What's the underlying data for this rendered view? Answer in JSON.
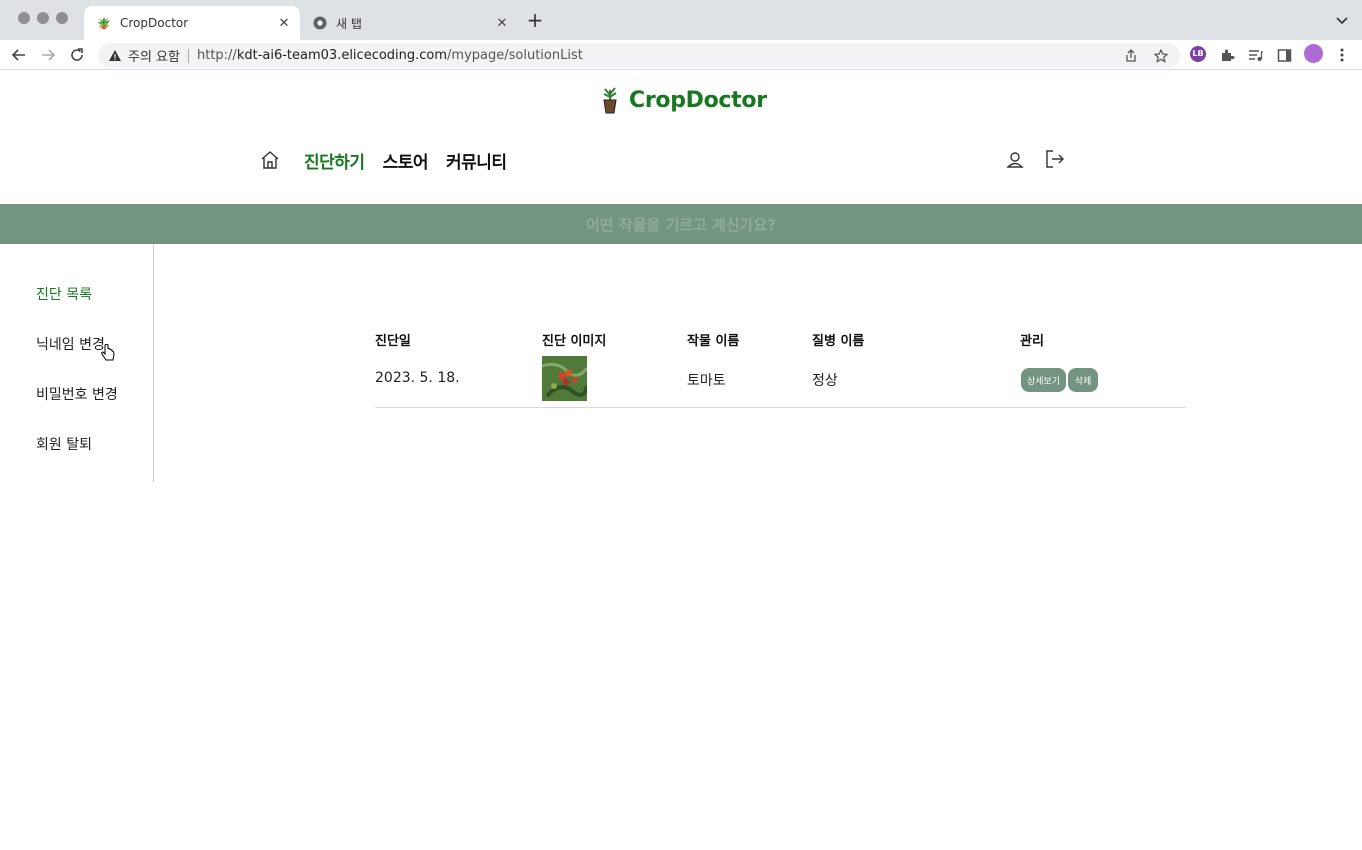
{
  "browser": {
    "tabs": [
      {
        "title": "CropDoctor",
        "active": true
      },
      {
        "title": "새 탭",
        "active": false
      }
    ],
    "new_tab_label": "+",
    "security_label": "주의 요함",
    "url_prefix": "http://",
    "url_host": "kdt-ai6-team03.elicecoding.com",
    "url_path": "/mypage/solutionList",
    "extension_label": "LB"
  },
  "site": {
    "name": "CropDoctor",
    "nav": [
      {
        "label": "진단하기",
        "active": true
      },
      {
        "label": "스토어",
        "active": false
      },
      {
        "label": "커뮤니티",
        "active": false
      }
    ],
    "banner": "어떤 작물을 기르고 계신가요?",
    "brand_color": "#17781f",
    "accent_color": "#739480"
  },
  "sidebar": {
    "items": [
      {
        "label": "진단 목록",
        "active": true
      },
      {
        "label": "닉네임 변경",
        "active": false
      },
      {
        "label": "비밀번호 변경",
        "active": false
      },
      {
        "label": "회원 탈퇴",
        "active": false
      }
    ]
  },
  "table": {
    "headers": [
      "진단일",
      "진단 이미지",
      "작물 이름",
      "질병 이름",
      "관리"
    ],
    "rows": [
      {
        "date": "2023. 5. 18.",
        "image": "tomato-plant-photo",
        "crop": "토마토",
        "disease": "정상",
        "detail_label": "상세보기",
        "delete_label": "삭제"
      }
    ]
  }
}
